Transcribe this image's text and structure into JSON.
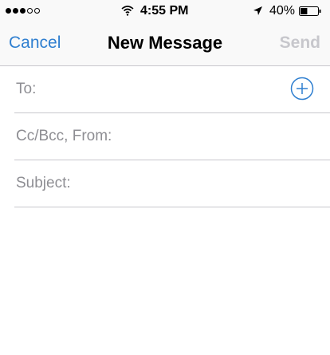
{
  "status_bar": {
    "signal_bars_filled": 3,
    "signal_bars_total": 5,
    "time": "4:55 PM",
    "battery_percent": "40%",
    "battery_level": 0.4
  },
  "nav": {
    "cancel_label": "Cancel",
    "title": "New Message",
    "send_label": "Send"
  },
  "fields": {
    "to_label": "To:",
    "cc_bcc_label": "Cc/Bcc, From:",
    "subject_label": "Subject:"
  },
  "colors": {
    "accent": "#2f7fd0",
    "disabled": "#c7c7cc",
    "label_gray": "#8e8e93",
    "separator": "#c8c7cc"
  },
  "icons": {
    "add_contact": "plus-circle-icon",
    "wifi": "wifi-icon",
    "location": "location-arrow-icon",
    "battery": "battery-icon"
  }
}
